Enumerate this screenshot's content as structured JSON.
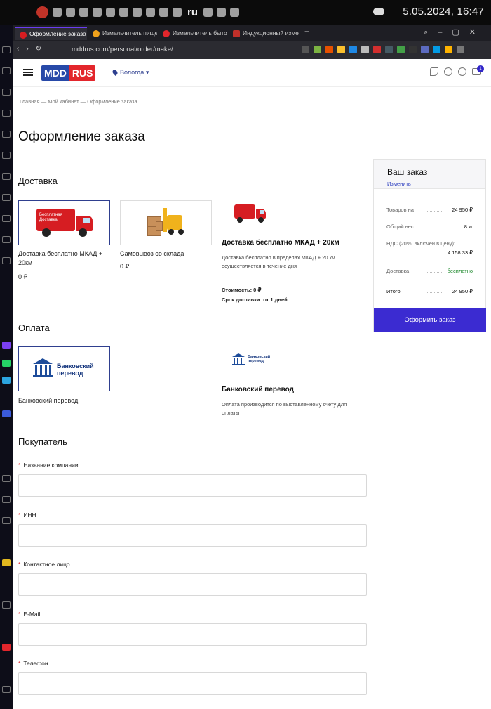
{
  "system_bar": {
    "clock": "5.05.2024, 16:47",
    "lang": "ru"
  },
  "browser": {
    "tabs": [
      {
        "label": "Оформление заказа |"
      },
      {
        "label": "Измельчитель пищев"
      },
      {
        "label": "Измельчитель бытов"
      },
      {
        "label": "Индукционный изме"
      }
    ],
    "url": "mddrus.com/personal/order/make/"
  },
  "header": {
    "logo_a": "MDD",
    "logo_b": "RUS",
    "city": "Вологда",
    "cart_count": "1"
  },
  "breadcrumb": "Главная — Мой кабинет — Оформление заказа",
  "page_title": "Оформление заказа",
  "delivery": {
    "heading": "Доставка",
    "options": [
      {
        "label": "Доставка бесплатно МКАД + 20км",
        "price": "0 ₽",
        "truck_text": "Бесплатная Доставка"
      },
      {
        "label": "Самовывоз со склада",
        "price": "0 ₽"
      }
    ],
    "detail": {
      "title": "Доставка бесплатно МКАД + 20км",
      "text": "Доставка бесплатно в пределах МКАД + 20 км осуществляется в течение дня",
      "cost_label": "Стоимость:",
      "cost": "0 ₽",
      "term_label": "Срок доставки:",
      "term": "от 1 дней"
    }
  },
  "payment": {
    "heading": "Оплата",
    "option": {
      "label": "Банковский перевод",
      "logo_text": "Банковский перевод"
    },
    "detail": {
      "title": "Банковский перевод",
      "text": "Оплата производится по выставленному счету для оплаты"
    }
  },
  "buyer": {
    "heading": "Покупатель",
    "fields": [
      {
        "label": "Название компании"
      },
      {
        "label": "ИНН"
      },
      {
        "label": "Контактное лицо"
      },
      {
        "label": "E-Mail"
      },
      {
        "label": "Телефон"
      }
    ]
  },
  "summary": {
    "title": "Ваш заказ",
    "change": "Изменить",
    "goods_label": "Товаров на",
    "goods": "24 950 ₽",
    "weight_label": "Общий вес",
    "weight": "8 кг",
    "vat_label": "НДС (20%, включен в цену):",
    "vat": "4 158.33 ₽",
    "delivery_label": "Доставка",
    "delivery": "бесплатно",
    "total_label": "Итого",
    "total": "24 950 ₽",
    "button": "Оформить заказ"
  }
}
